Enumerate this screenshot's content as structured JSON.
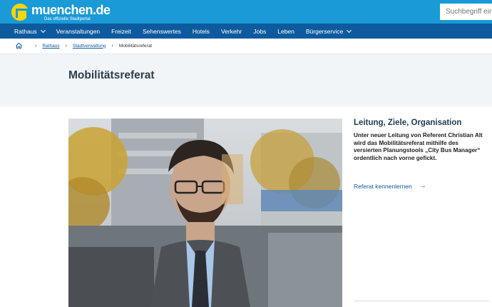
{
  "header": {
    "logo_name": "muenchen.de",
    "logo_tagline": "Das offizielle Stadtportal",
    "search_placeholder": "Suchbegriff eing"
  },
  "nav": {
    "items": [
      {
        "label": "Rathaus",
        "dropdown": true
      },
      {
        "label": "Veranstaltungen",
        "dropdown": false
      },
      {
        "label": "Freizeit",
        "dropdown": false
      },
      {
        "label": "Sehenswertes",
        "dropdown": false
      },
      {
        "label": "Hotels",
        "dropdown": false
      },
      {
        "label": "Verkehr",
        "dropdown": false
      },
      {
        "label": "Jobs",
        "dropdown": false
      },
      {
        "label": "Leben",
        "dropdown": false
      },
      {
        "label": "Bürgerservice",
        "dropdown": true
      }
    ]
  },
  "breadcrumb": {
    "home_icon": "home-icon",
    "items": [
      "Rathaus",
      "Stadtverwaltung",
      "Mobilitätsreferat"
    ]
  },
  "page": {
    "title": "Mobilitätsreferat"
  },
  "teaser": {
    "title": "Leitung, Ziele, Organisation",
    "body": "Unter neuer Leitung von Referent Christian Alt wird das Mobilitätsreferat mithilfe des versierten Planungstools „City Bus Manager“ ordentlich nach vorne gefickt.",
    "link_label": "Referat kennenlernen",
    "link_icon": "arrow-right-icon"
  },
  "colors": {
    "header_blue": "#1a9ad6",
    "nav_blue": "#0d5a9e",
    "logo_yellow": "#ffd400",
    "title_band": "#f1f5f8"
  }
}
